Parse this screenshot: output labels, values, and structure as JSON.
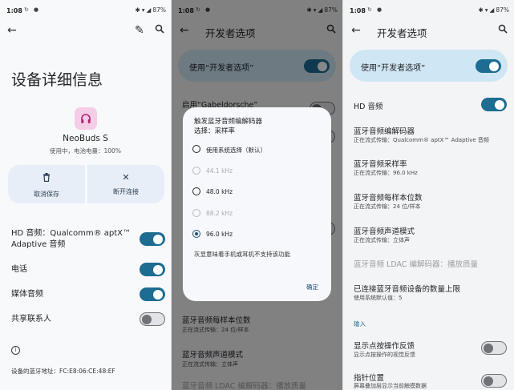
{
  "status_bar": {
    "time": "1:08",
    "battery": "87%"
  },
  "screen1": {
    "title": "设备详细信息",
    "device_name": "NeoBuds S",
    "device_status": "使用中，电池电量：100%",
    "actions": {
      "forget": "取消保存",
      "disconnect": "断开连接"
    },
    "rows": [
      {
        "label_line1": "HD 音频：Qualcomm® aptX™",
        "label_line2": "Adaptive 音频",
        "on": true
      },
      {
        "label": "电话",
        "on": true
      },
      {
        "label": "媒体音频",
        "on": true
      },
      {
        "label": "共享联系人",
        "on": false
      }
    ],
    "bt_address": "设备的蓝牙地址：FC:E8:06:CE:48:EF"
  },
  "screen2": {
    "title": "开发者选项",
    "master_label": "使用“开发者选项”",
    "bg_row_top": "启用“Gabeldorsche”",
    "bg_rows": [
      {
        "title": "蓝牙音频每样本位数",
        "sub": "正在流式传输：24 位/样本"
      },
      {
        "title": "蓝牙音频声道模式",
        "sub": "正在流式传输：立体声"
      },
      {
        "title": "蓝牙音频 LDAC 编解码器：播放质量"
      }
    ],
    "dialog": {
      "title_line1": "触发蓝牙音频编解码器",
      "title_line2": "选择：采样率",
      "options": [
        {
          "label": "使用系统选择（默认）",
          "state": "enabled"
        },
        {
          "label": "44.1 kHz",
          "state": "disabled"
        },
        {
          "label": "48.0 kHz",
          "state": "enabled"
        },
        {
          "label": "88.2 kHz",
          "state": "disabled"
        },
        {
          "label": "96.0 kHz",
          "state": "selected"
        }
      ],
      "note": "灰显意味着手机或耳机不支持该功能",
      "confirm": "确定"
    }
  },
  "screen3": {
    "title": "开发者选项",
    "master_label": "使用“开发者选项”",
    "hd_audio": "HD 音频",
    "rows": [
      {
        "title": "蓝牙音频编解码器",
        "sub": "正在流式传输：Qualcomm® aptX™ Adaptive 音频"
      },
      {
        "title": "蓝牙音频采样率",
        "sub": "正在流式传输：96.0 kHz"
      },
      {
        "title": "蓝牙音频每样本位数",
        "sub": "正在流式传输：24 位/样本"
      },
      {
        "title": "蓝牙音频声道模式",
        "sub": "正在流式传输：立体声"
      }
    ],
    "ldac_disabled": "蓝牙音频 LDAC 编解码器：播放质量",
    "max_devices": {
      "title": "已连接蓝牙音频设备的数量上限",
      "sub": "使用系统默认值：5"
    },
    "section_input": "输入",
    "show_taps": {
      "title": "显示点按操作反馈",
      "sub": "显示点按操作的视觉反馈"
    },
    "pointer_location": {
      "title": "指针位置",
      "sub": "屏幕叠加层显示当前触摸数据"
    }
  }
}
